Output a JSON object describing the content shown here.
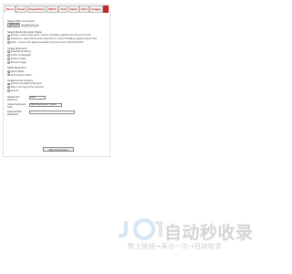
{
  "tabs": [
    {
      "label": "Word",
      "active": true
    },
    {
      "label": "Excel",
      "active": false
    },
    {
      "label": "PowerPoint",
      "active": false
    },
    {
      "label": "PDF/A",
      "active": false
    },
    {
      "label": "Text",
      "active": false
    },
    {
      "label": "Table",
      "active": false
    },
    {
      "label": "Html",
      "active": false
    },
    {
      "label": "Images",
      "active": false
    }
  ],
  "file": {
    "label": "Select PDF to Convert",
    "button": "选择文件",
    "status": "未选择任何文件"
  },
  "reconstruction": {
    "label": "Select Reconstruction Mode",
    "options": [
      {
        "label": "Flowing - recover page layout, columns, formatting, graphics and preserve text flow",
        "selected": true
      },
      {
        "label": "Continuous - detect source and recover all text, recover formatting, graphics and text flow",
        "selected": false
      },
      {
        "label": "Exact - recover exact page presentation using text boxes in Microsoft Word",
        "selected": false
      }
    ]
  },
  "image_recovery": {
    "label": "Image Recovery",
    "options": [
      {
        "label": "Automatic Anchoring",
        "selected": true
      },
      {
        "label": "Anchor to Paragraph",
        "selected": false
      },
      {
        "label": "Anchor to Page",
        "selected": false
      },
      {
        "label": "Remove Images",
        "selected": false
      }
    ]
  },
  "table_detection": {
    "label": "Table Detection",
    "options": [
      {
        "label": "Detect Tables",
        "selected": true
      },
      {
        "label": "Do Not Detect Tables",
        "selected": false
      }
    ]
  },
  "headers": {
    "label": "Headers and Footers",
    "options": [
      {
        "label": "Recover as headers and footers",
        "selected": true
      },
      {
        "label": "Place in the body of the document",
        "selected": false
      },
      {
        "label": "Remove",
        "selected": false
      }
    ]
  },
  "ocr": {
    "label": "Optical Text Recovery",
    "value": "Auto"
  },
  "output_type": {
    "label": "Output Document Type",
    "value": "Word Document (*.docx)"
  },
  "password": {
    "label": "Optional PDF Password",
    "value": ""
  },
  "start_button": "Start Conversion",
  "watermark": {
    "title": "自动秒收录",
    "subtitle": "数上链接→来访一次→自动收录"
  }
}
